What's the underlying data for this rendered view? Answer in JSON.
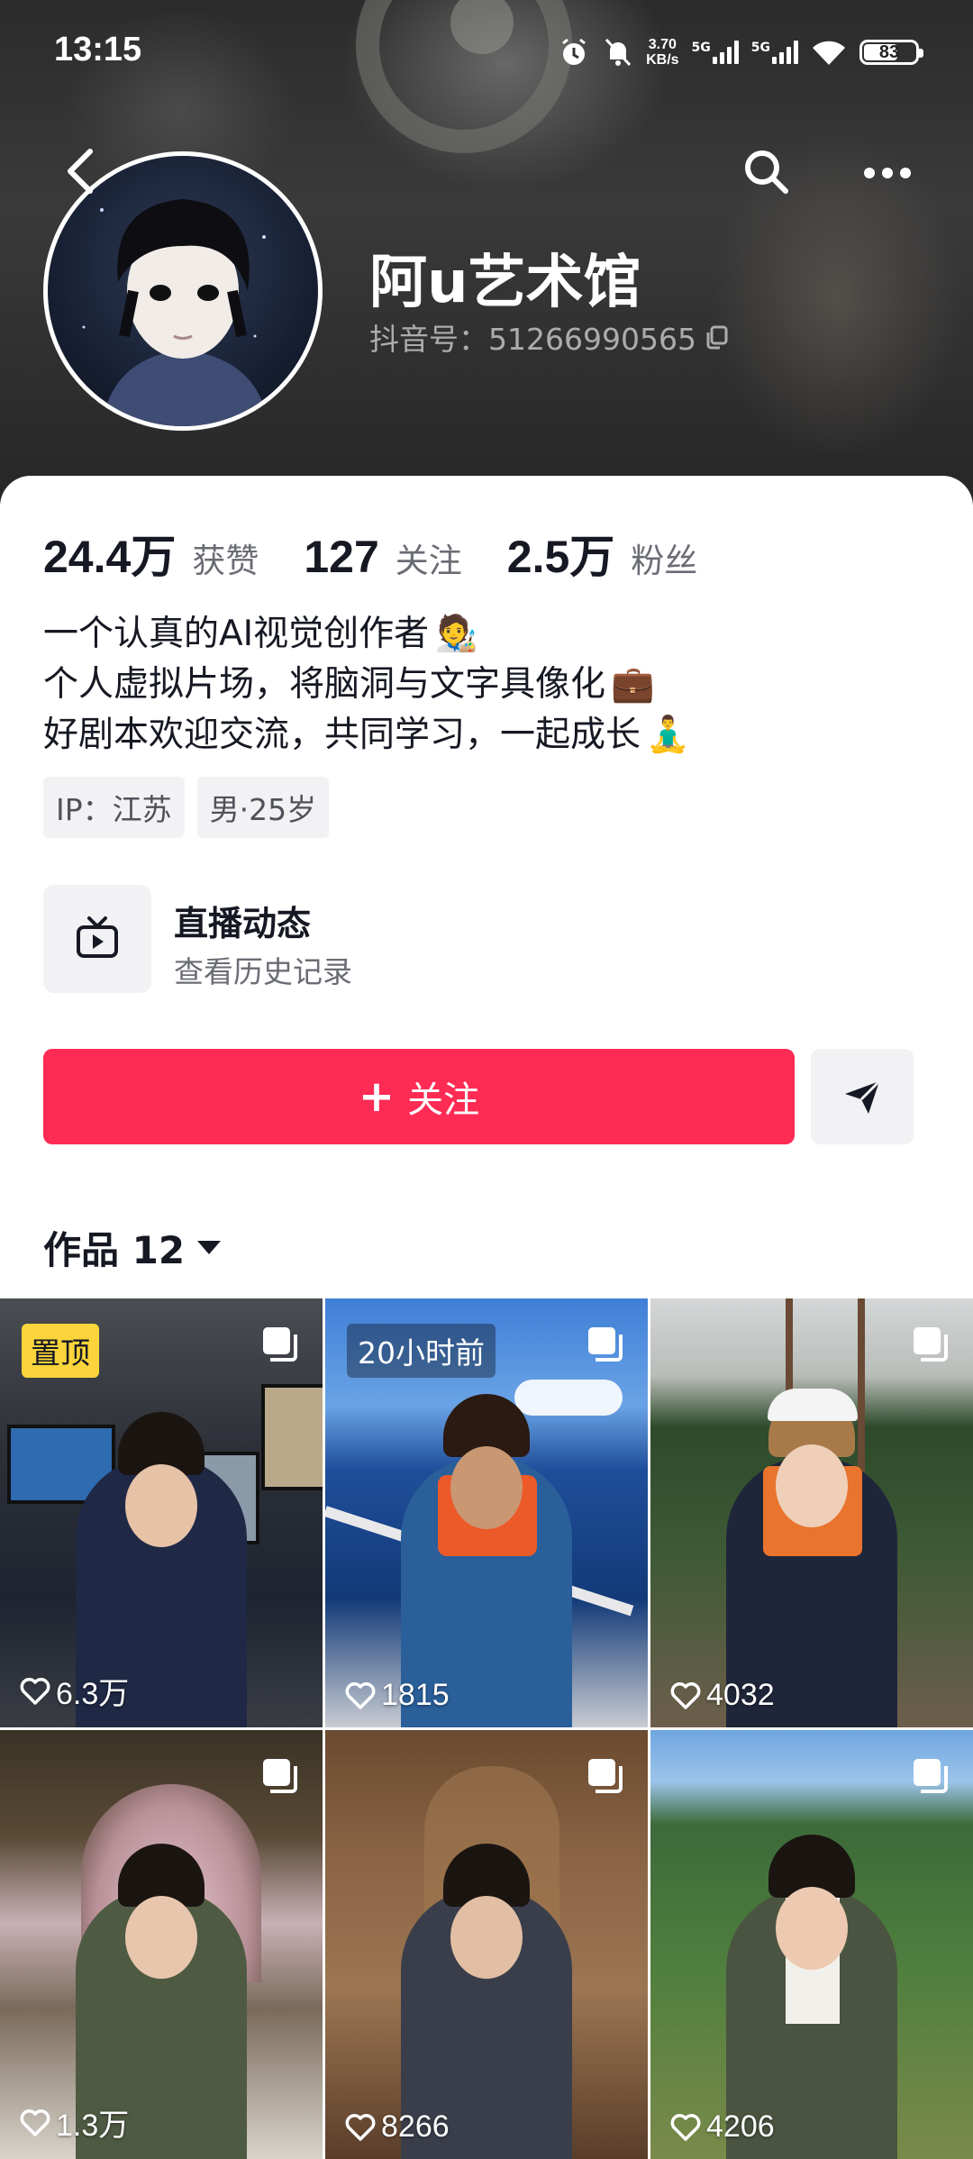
{
  "status_bar": {
    "time": "13:15",
    "speed_value": "3.70",
    "speed_unit": "KB/s",
    "network_1": "5G",
    "network_2": "5G",
    "battery": "83"
  },
  "profile": {
    "nickname": "阿u艺术馆",
    "douyin_id": "抖音号：51266990565"
  },
  "stats": [
    {
      "value": "24.4万",
      "label": "获赞"
    },
    {
      "value": "127",
      "label": "关注"
    },
    {
      "value": "2.5万",
      "label": "粉丝"
    }
  ],
  "bio": {
    "line1": "一个认真的AI视觉创作者",
    "line1_emoji": "🧑‍🎨",
    "line2": "个人虚拟片场，将脑洞与文字具像化",
    "line2_emoji": "💼",
    "line3": "好剧本欢迎交流，共同学习，一起成长",
    "line3_emoji": "🧘‍♂️"
  },
  "tags": [
    "IP：江苏",
    "男·25岁"
  ],
  "live": {
    "title": "直播动态",
    "subtitle": "查看历史记录"
  },
  "actions": {
    "follow_icon": "+",
    "follow_label": "关注"
  },
  "works_tab": {
    "label": "作品 12"
  },
  "videos": [
    {
      "likes": "6.3万",
      "badge": "置顶"
    },
    {
      "likes": "1815",
      "badge": "20小时前"
    },
    {
      "likes": "4032"
    },
    {
      "likes": "1.3万"
    },
    {
      "likes": "8266"
    },
    {
      "likes": "4206"
    }
  ],
  "colors": {
    "accent": "#fe2c55",
    "pin_badge": "#fad43a"
  },
  "icons": [
    "back-arrow-icon",
    "search-icon",
    "more-icon",
    "copy-icon",
    "tv-icon",
    "share-icon",
    "heart-icon",
    "multi-image-icon"
  ]
}
